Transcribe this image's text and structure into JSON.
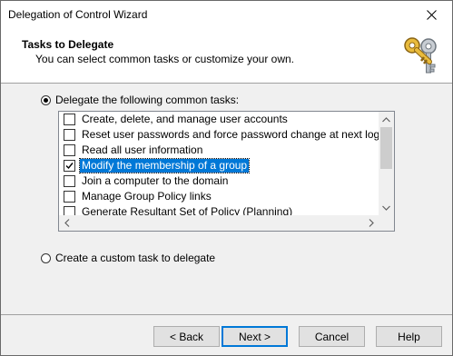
{
  "window": {
    "title": "Delegation of Control Wizard"
  },
  "header": {
    "title": "Tasks to Delegate",
    "subtitle": "You can select common tasks or customize your own."
  },
  "options": {
    "common_label": "Delegate the following common tasks:",
    "common_selected": true,
    "custom_label": "Create a custom task to delegate",
    "custom_selected": false
  },
  "tasks": [
    {
      "label": "Create, delete, and manage user accounts",
      "checked": false,
      "selected": false
    },
    {
      "label": "Reset user passwords and force password change at next logon",
      "checked": false,
      "selected": false
    },
    {
      "label": "Read all user information",
      "checked": false,
      "selected": false
    },
    {
      "label": "Modify the membership of a group",
      "checked": true,
      "selected": true
    },
    {
      "label": "Join a computer to the domain",
      "checked": false,
      "selected": false
    },
    {
      "label": "Manage Group Policy links",
      "checked": false,
      "selected": false
    },
    {
      "label": "Generate Resultant Set of Policy (Planning)",
      "checked": false,
      "selected": false
    }
  ],
  "buttons": {
    "back": "< Back",
    "next": "Next >",
    "cancel": "Cancel",
    "help": "Help"
  },
  "icons": {
    "close": "close-icon",
    "keys": "keys-icon"
  },
  "colors": {
    "selection": "#0078d7",
    "key_gold": "#d9a520",
    "key_silver": "#9aa3ad"
  }
}
